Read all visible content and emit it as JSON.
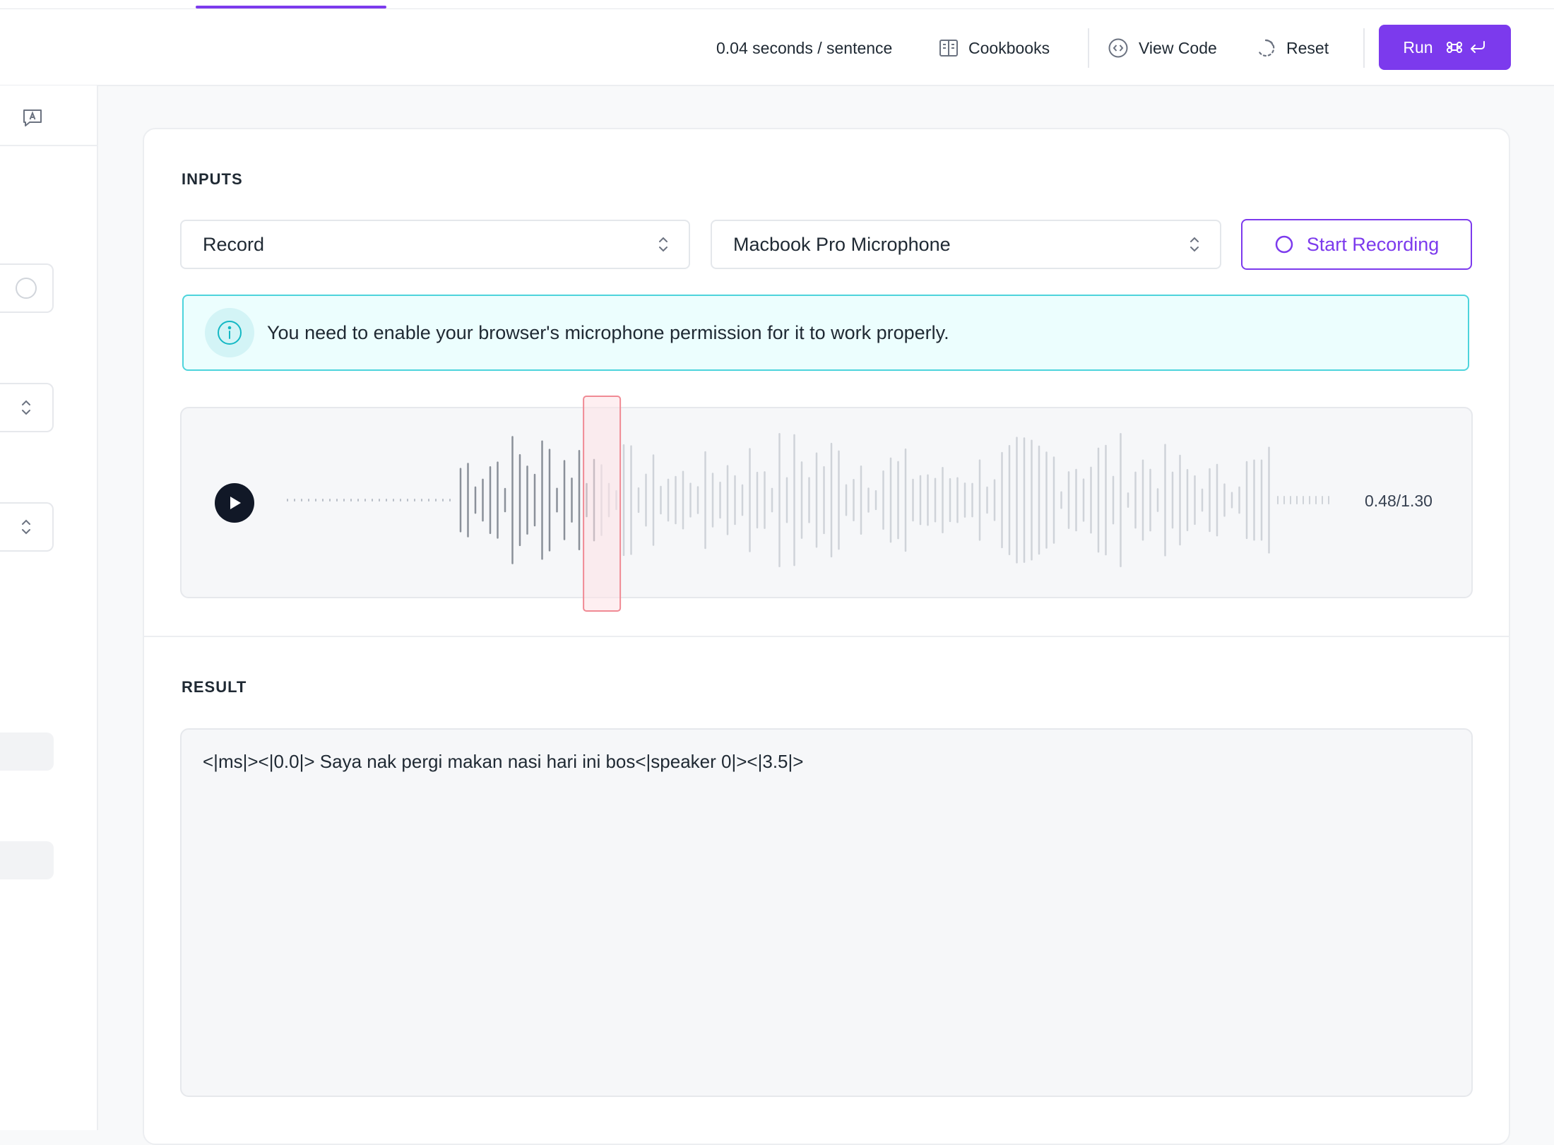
{
  "header": {
    "speed": "0.04 seconds / sentence",
    "cookbooks_label": "Cookbooks",
    "view_code_label": "View Code",
    "reset_label": "Reset",
    "run_label": "Run"
  },
  "inputs": {
    "section_label": "INPUTS",
    "source_select": "Record",
    "device_select": "Macbook Pro Microphone",
    "start_recording_label": "Start Recording",
    "info_message": "You need to enable your browser's microphone permission for it to work properly.",
    "player": {
      "time": "0.48/1.30",
      "progress": 0.37
    }
  },
  "result": {
    "section_label": "RESULT",
    "text": "<|ms|><|0.0|> Saya nak pergi makan nasi hari ini bos<|speaker 0|><|3.5|>"
  },
  "colors": {
    "accent": "#7c3aed",
    "info_border": "#4dd4dc",
    "info_bg": "#ecfefe",
    "playhead": "#f08a94"
  }
}
